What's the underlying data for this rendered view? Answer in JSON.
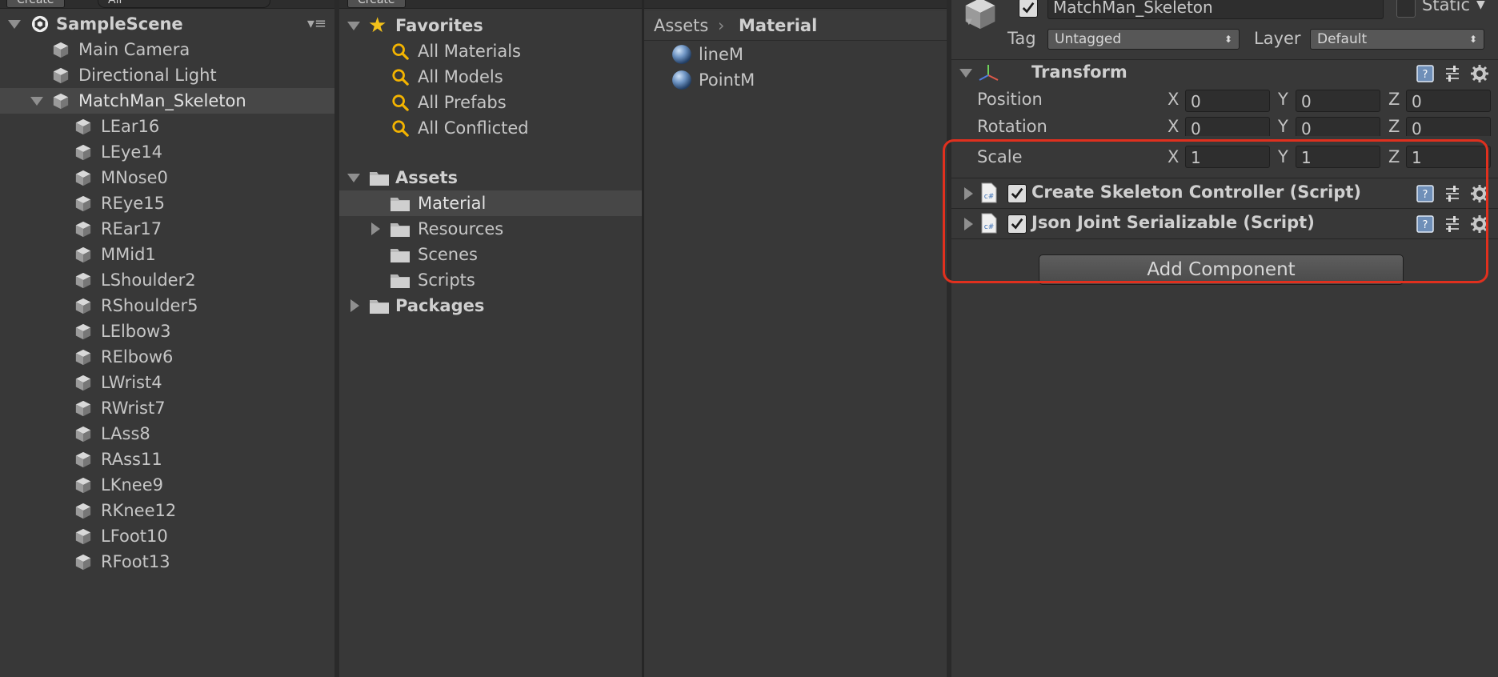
{
  "hierarchy": {
    "create_label": "Create",
    "search_text": "All",
    "scene_name": "SampleScene",
    "items": [
      {
        "label": "Main Camera"
      },
      {
        "label": "Directional Light"
      },
      {
        "label": "MatchMan_Skeleton"
      },
      {
        "label": "LEar16"
      },
      {
        "label": "LEye14"
      },
      {
        "label": "MNose0"
      },
      {
        "label": "REye15"
      },
      {
        "label": "REar17"
      },
      {
        "label": "MMid1"
      },
      {
        "label": "LShoulder2"
      },
      {
        "label": "RShoulder5"
      },
      {
        "label": "LElbow3"
      },
      {
        "label": "RElbow6"
      },
      {
        "label": "LWrist4"
      },
      {
        "label": "RWrist7"
      },
      {
        "label": "LAss8"
      },
      {
        "label": "RAss11"
      },
      {
        "label": "LKnee9"
      },
      {
        "label": "RKnee12"
      },
      {
        "label": "LFoot10"
      },
      {
        "label": "RFoot13"
      }
    ]
  },
  "project": {
    "create_label": "Create",
    "favorites_label": "Favorites",
    "favorites": [
      "All Materials",
      "All Models",
      "All Prefabs",
      "All Conflicted"
    ],
    "assets_label": "Assets",
    "folders": [
      "Material",
      "Resources",
      "Scenes",
      "Scripts"
    ],
    "packages_label": "Packages"
  },
  "asset_view": {
    "breadcrumb_root": "Assets",
    "breadcrumb_current": "Material",
    "items": [
      "lineM",
      "PointM"
    ]
  },
  "inspector": {
    "object_name": "MatchMan_Skeleton",
    "static_label": "Static",
    "tag_label": "Tag",
    "tag_value": "Untagged",
    "layer_label": "Layer",
    "layer_value": "Default",
    "transform_label": "Transform",
    "position_label": "Position",
    "rotation_label": "Rotation",
    "scale_label": "Scale",
    "x": "X",
    "y": "Y",
    "z": "Z",
    "position": {
      "x": "0",
      "y": "0",
      "z": "0"
    },
    "rotation": {
      "x": "0",
      "y": "0",
      "z": "0"
    },
    "scale": {
      "x": "1",
      "y": "1",
      "z": "1"
    },
    "component1": "Create Skeleton Controller (Script)",
    "component2": "Json Joint Serializable (Script)",
    "add_component": "Add Component"
  },
  "colors": {
    "panel_bg": "#383838",
    "selection": "#474747",
    "highlight_box": "#e0301e"
  }
}
